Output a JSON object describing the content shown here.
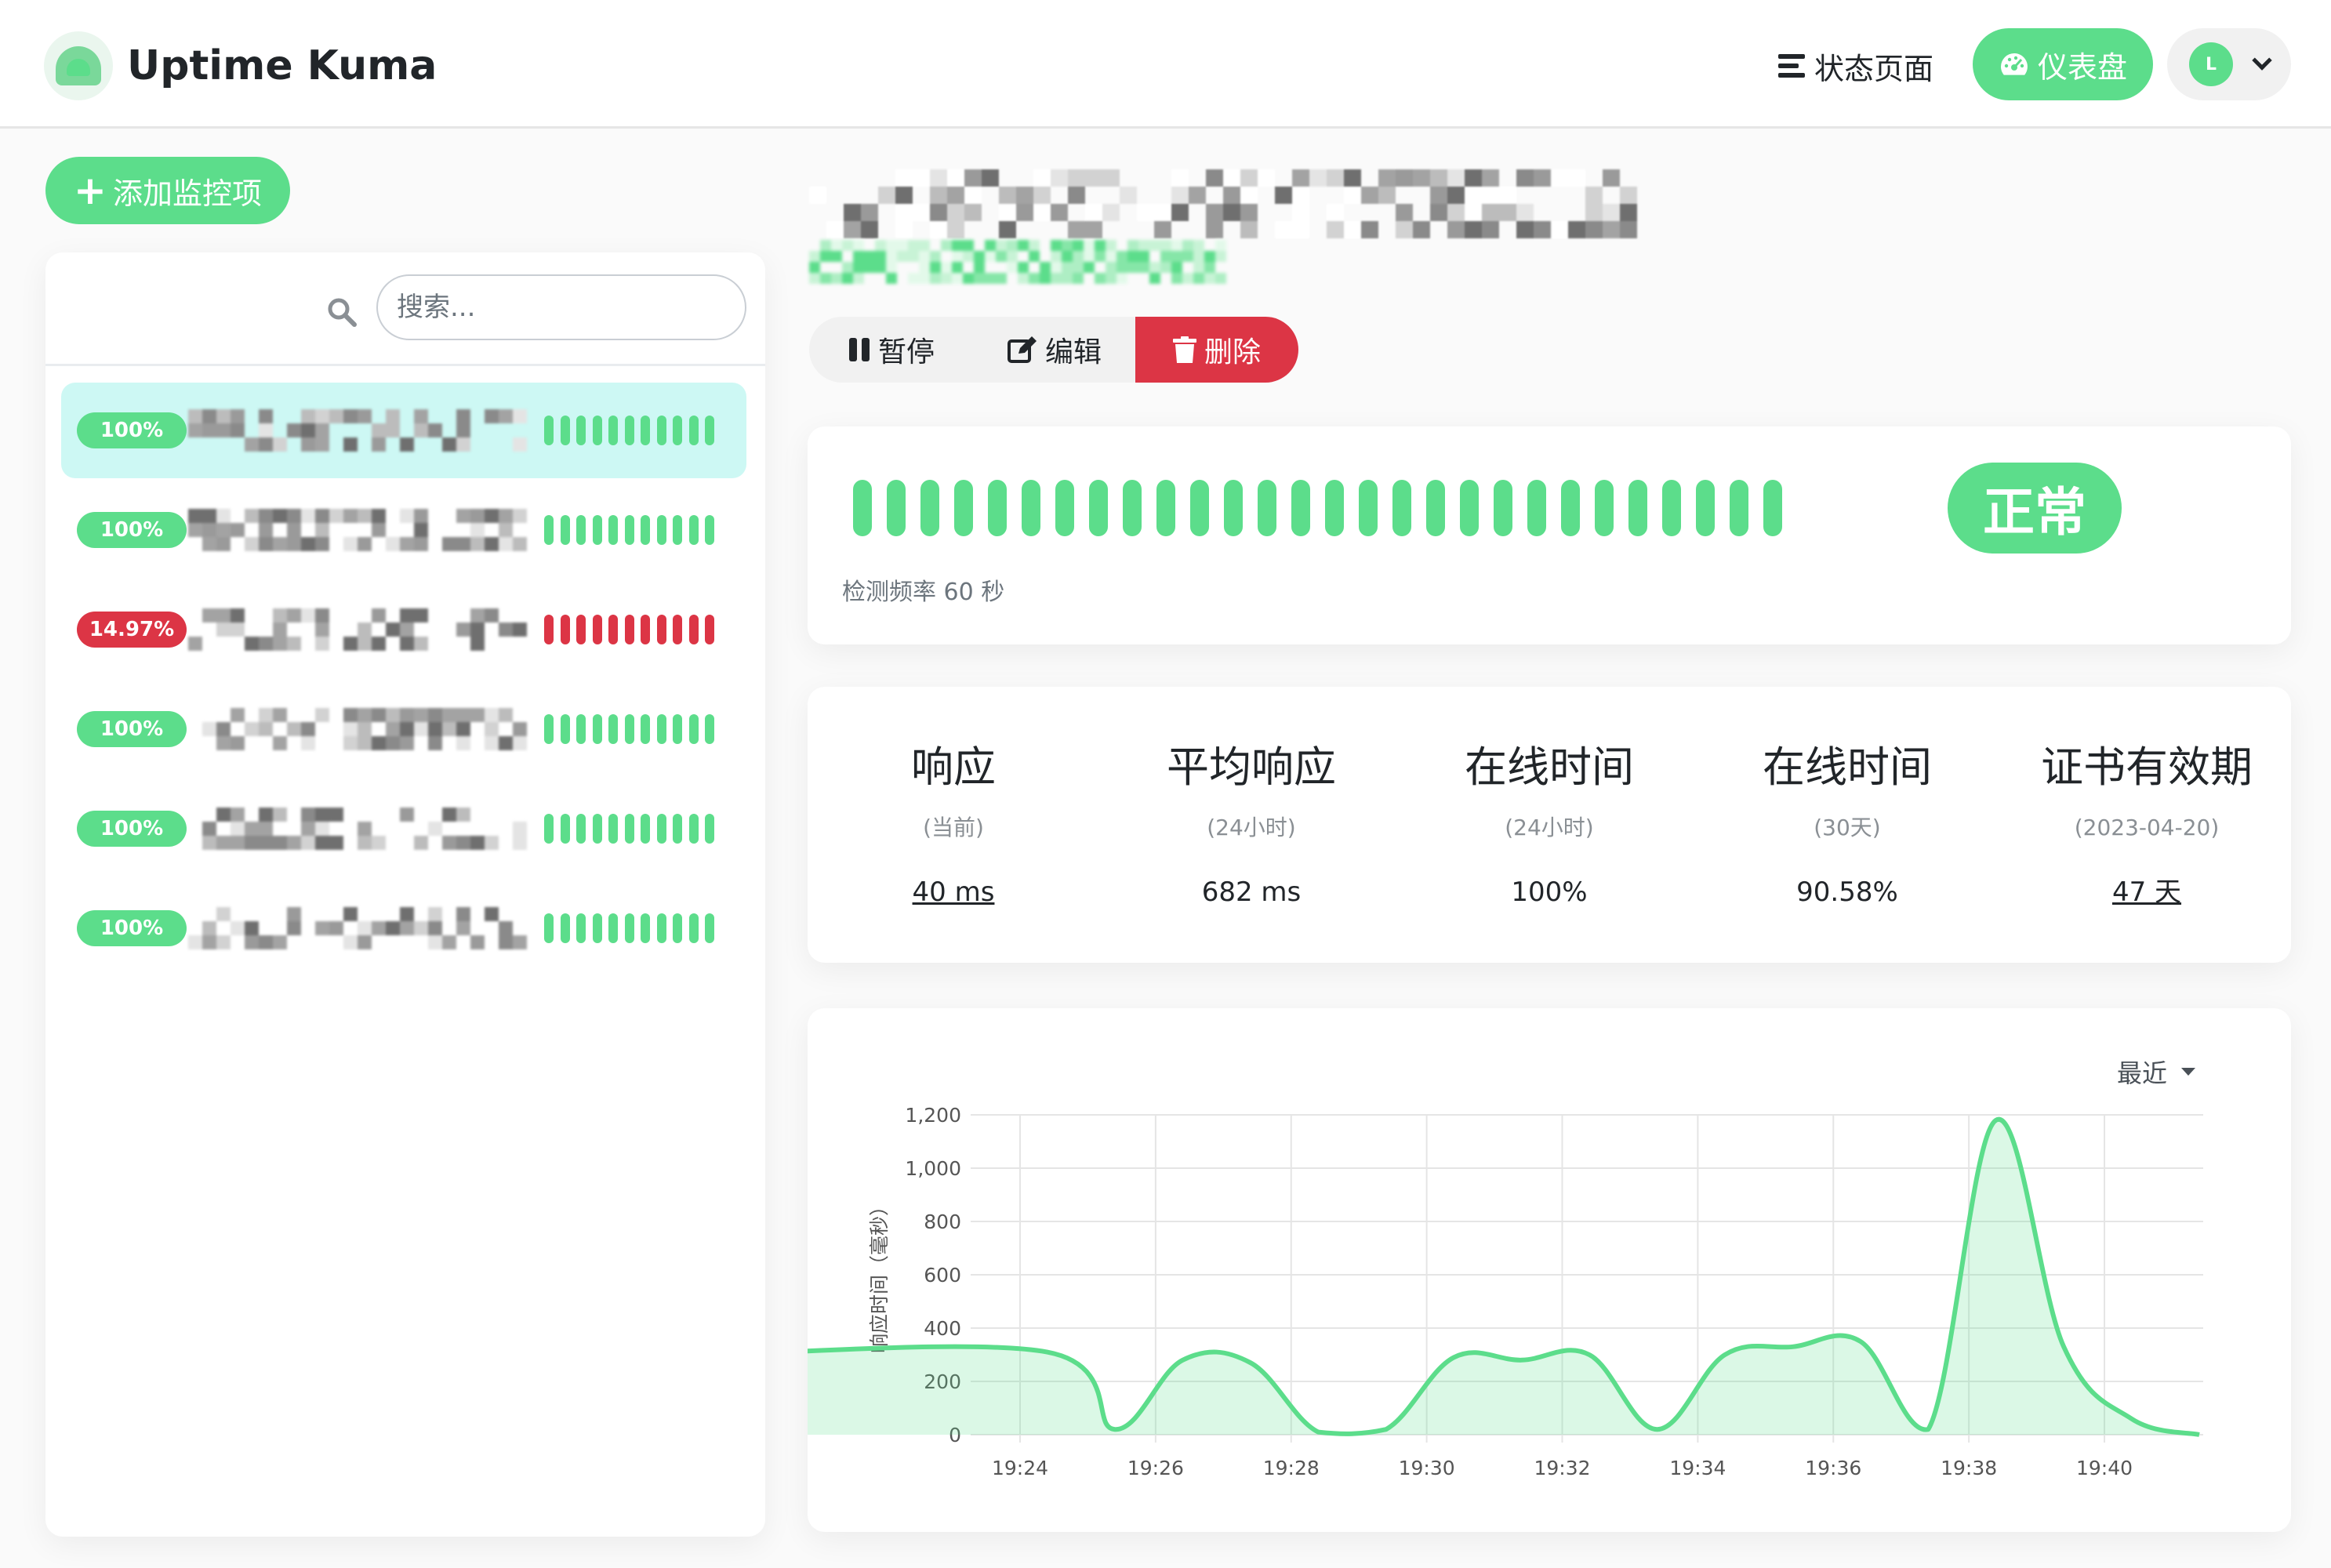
{
  "app": {
    "name": "Uptime Kuma",
    "nav": {
      "status_page": "状态页面",
      "dashboard": "仪表盘"
    },
    "user_initial": "L"
  },
  "sidebar": {
    "add_button": "添加监控项",
    "search_placeholder": "搜索...",
    "monitors": [
      {
        "uptime": "100%",
        "status": "up"
      },
      {
        "uptime": "100%",
        "status": "up"
      },
      {
        "uptime": "14.97%",
        "status": "down"
      },
      {
        "uptime": "100%",
        "status": "up"
      },
      {
        "uptime": "100%",
        "status": "up"
      },
      {
        "uptime": "100%",
        "status": "up"
      }
    ]
  },
  "detail": {
    "actions": {
      "pause": "暂停",
      "edit": "编辑",
      "delete": "删除"
    },
    "status": "正常",
    "check_interval": "检测频率 60 秒",
    "stats": [
      {
        "title": "响应",
        "subtitle": "(当前)",
        "value": "40 ms",
        "link": true
      },
      {
        "title": "平均响应",
        "subtitle": "(24小时)",
        "value": "682 ms",
        "link": false
      },
      {
        "title": "在线时间",
        "subtitle": "(24小时)",
        "value": "100%",
        "link": false
      },
      {
        "title": "在线时间",
        "subtitle": "(30天)",
        "value": "90.58%",
        "link": false
      },
      {
        "title": "证书有效期",
        "subtitle": "(2023-04-20)",
        "value": "47 天",
        "link": true
      }
    ],
    "period": "最近"
  },
  "colors": {
    "primary": "#5cdd8b",
    "danger": "#dc3545",
    "active_bg": "#cdf8f4"
  },
  "chart_data": {
    "type": "area",
    "ylabel": "响应时间（毫秒）",
    "ylim": [
      0,
      1200
    ],
    "yticks": [
      0,
      200,
      400,
      600,
      800,
      1000,
      1200
    ],
    "xticks": [
      "19:24",
      "19:26",
      "19:28",
      "19:30",
      "19:32",
      "19:34",
      "19:36",
      "19:38",
      "19:40"
    ],
    "x_minutes": [
      19.5,
      24.4,
      25.4,
      26.4,
      27.4,
      28.4,
      29.4,
      30.4,
      31.4,
      32.4,
      33.4,
      34.4,
      35.4,
      36.4,
      37.4,
      38.4,
      39.4,
      40.4,
      41.4
    ],
    "series": [
      {
        "values": [
          300,
          310,
          20,
          280,
          270,
          10,
          20,
          290,
          280,
          300,
          20,
          300,
          330,
          350,
          20,
          1180,
          330,
          60,
          0
        ]
      }
    ],
    "line_color": "#5cdd8b",
    "grid": true
  }
}
